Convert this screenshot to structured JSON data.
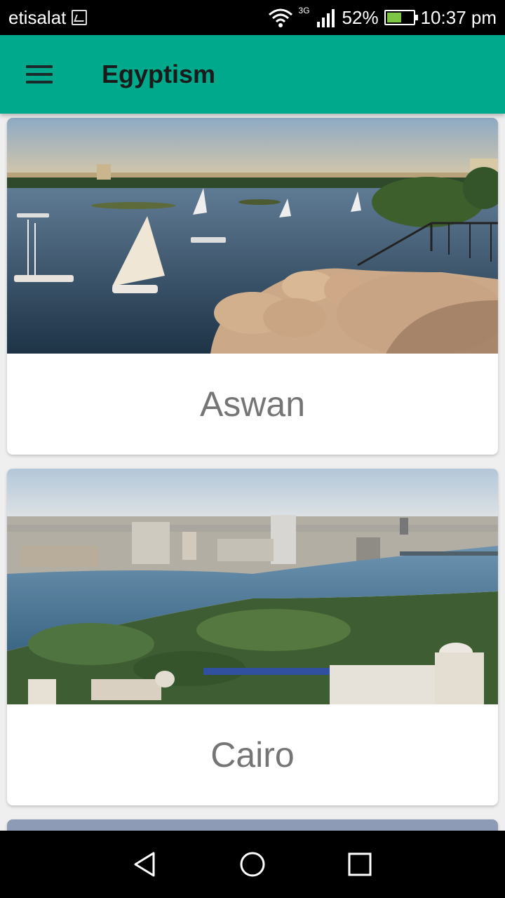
{
  "status_bar": {
    "carrier": "etisalat",
    "network": "3G",
    "battery": "52%",
    "battery_level": 0.52,
    "time": "10:37 pm"
  },
  "app_bar": {
    "title": "Egyptism",
    "menu_icon": "hamburger-menu-icon"
  },
  "cities": [
    {
      "name": "Aswan",
      "image": "aswan-nile-feluccas-photo"
    },
    {
      "name": "Cairo",
      "image": "cairo-nile-skyline-photo"
    }
  ],
  "nav": {
    "back_icon": "back-triangle-icon",
    "home_icon": "home-circle-icon",
    "recents_icon": "recents-square-icon"
  },
  "colors": {
    "app_bar": "#00a98b",
    "background": "#efefef",
    "caption_text": "#757575"
  }
}
